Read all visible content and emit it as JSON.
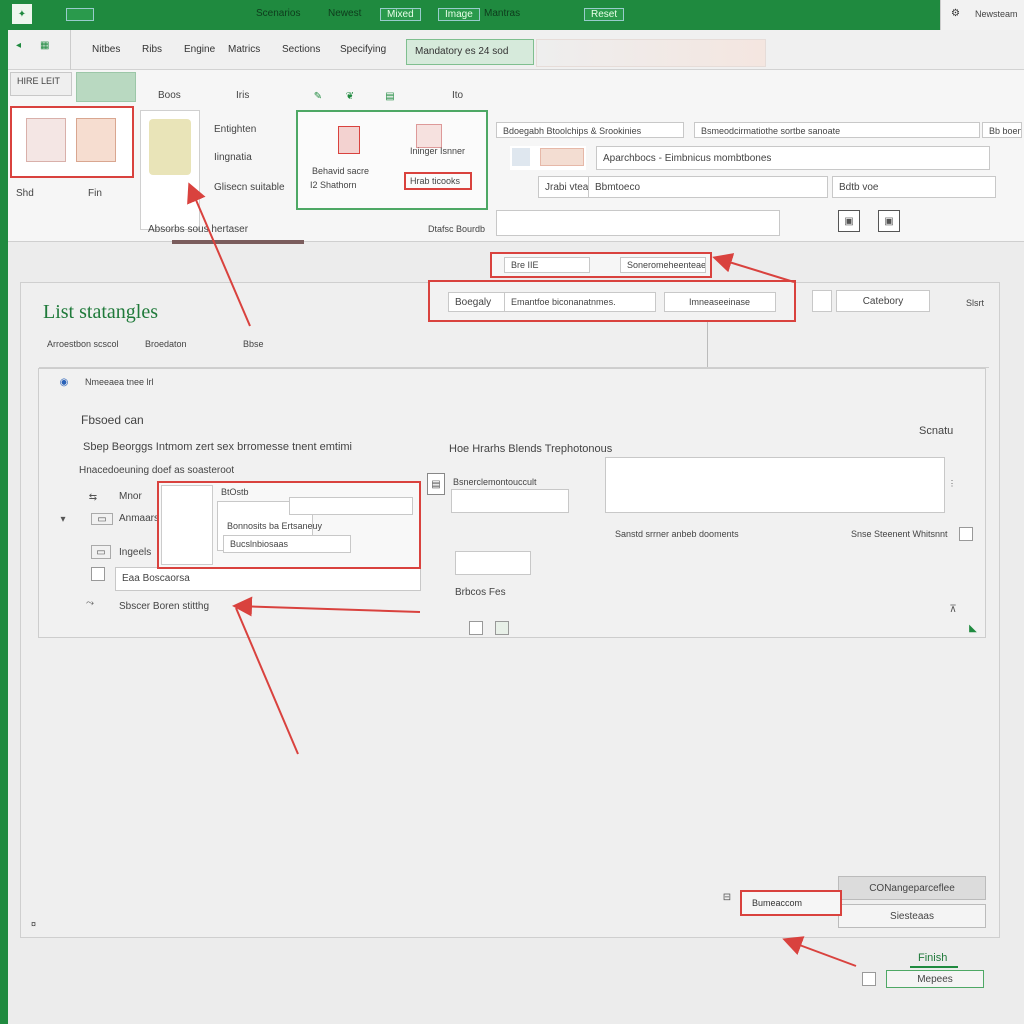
{
  "titlebar": {
    "items": [
      "Scenarios",
      "Newest",
      "Mixed",
      "Image",
      "Mantras",
      "Reset"
    ],
    "right_label": "Newsteam"
  },
  "tabs": {
    "items": [
      "Nitbes",
      "Ribs",
      "Engine",
      "Matrics",
      "Sections",
      "Specifying"
    ],
    "active_label": "Mandatory es 24 sod"
  },
  "ribbon": {
    "left_label": "HIRE LEIT",
    "thumb_labels": [
      "Shd",
      "Fin"
    ],
    "group_caption": "Absorbs sous hertaser",
    "list_items": [
      "Entighten",
      "Iingnatia",
      "Glisecn suitable"
    ],
    "tool_labels": [
      "Boos",
      "Iris",
      "Ito"
    ],
    "popup": {
      "row1": "Behavid sacre",
      "row2": "I2 Shathorn",
      "red_button": "Hrab ticooks",
      "caption": "Ininger Isnner",
      "sub_caption": "Dtafsc Bourdb"
    },
    "header_fields": [
      "Bdoegabh Btoolchips & Srookinies",
      "Bsmeodcirmatiothe sortbe sanoate",
      "Bb boen"
    ],
    "content_fields": [
      "Aparchbocs - Eimbnicus mombtbones",
      "Jrabi vteaunis pocts",
      "Bbmtoeco",
      "Bdtb voe"
    ],
    "bottom_field": ""
  },
  "subbar": {
    "field1": "Bre IIE",
    "field2": "Soneromeheenteaee"
  },
  "toolbar2": {
    "left": "Boegaly",
    "mid": "Emantfoe biconanatnmes.",
    "right": "Imneaseeinase",
    "category": "Catebory",
    "status": "Slsrt"
  },
  "page": {
    "title": "List statangles",
    "sub_links": [
      "Arroestbon scscol",
      "Broedaton",
      "Bbse"
    ]
  },
  "dialog": {
    "header": "Nmeeaea tnee lrl",
    "section_title": "Fbsoed can",
    "right_label": "Scnatu",
    "line1": "Sbep Beorggs Intmom zert sex brromesse tnent emtimi",
    "line2": "Hnacedoeuning doef as soasteroot",
    "right_line1": "Hoe Hrarhs Blends Trephotonous",
    "right_field_label": "Bsnerclemontouccult",
    "rows": [
      "Mnor",
      "Anmaars",
      "Ingeels",
      "Sbscer Boren stitthg"
    ],
    "popup_items": [
      "BtOstb",
      "Bonnosits ba Ertsaneuy",
      "Bucslnbiosaas"
    ],
    "input_label": "Eaa Boscaorsa",
    "hint1": "Sanstd srrner anbeb dooments",
    "hint2": "Snse Steenent Whitsnnt",
    "checkbox_label": "Brbcos Fes"
  },
  "footer": {
    "btn_primary": "CONangeparceflee",
    "btn_secondary": "Siesteaas",
    "red_button": "Bumeaccom",
    "finish_label": "Finish",
    "finish_button": "Mepees"
  },
  "colors": {
    "brand_green": "#1f8a3f",
    "highlight_red": "#d9423e",
    "panel_bg": "#efefef"
  }
}
